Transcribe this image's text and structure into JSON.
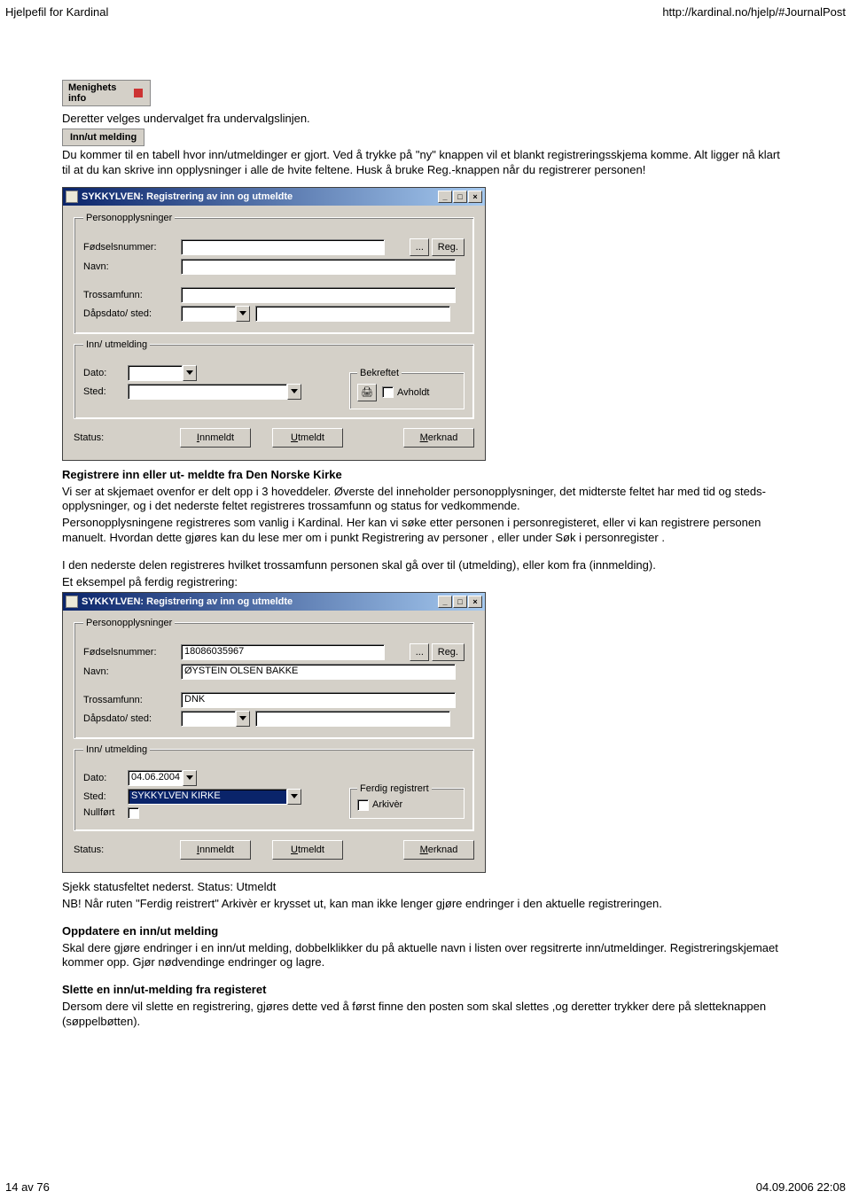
{
  "page": {
    "header_left": "Hjelpefil for Kardinal",
    "header_right": "http://kardinal.no/hjelp/#JournalPost",
    "footer_left": "14 av 76",
    "footer_right": "04.09.2006 22:08"
  },
  "menu_buttons": {
    "menighets_info": "Menighets\ninfo",
    "inn_ut_melding": "Inn/ut melding"
  },
  "text": {
    "p1": "Deretter velges undervalget fra undervalgslinjen.",
    "p2": "Du kommer til en tabell hvor inn/utmeldinger er gjort. Ved å trykke på \"ny\" knappen vil et blankt registreringsskjema komme. Alt ligger nå klart til at du kan skrive inn opplysninger i alle de hvite feltene. Husk å bruke Reg.-knappen når du registrerer personen!",
    "h1": "Registrere inn eller ut- meldte fra Den Norske Kirke",
    "p3": "Vi ser at skjemaet ovenfor er delt opp i 3 hoveddeler. Øverste del inneholder personopplysninger, det midterste feltet har med tid og steds-opplysninger, og i det nederste feltet registreres trossamfunn og status for vedkommende.",
    "p4": "Personopplysningene registreres som vanlig i Kardinal. Her kan vi søke etter personen i personregisteret, eller vi kan registrere personen manuelt. Hvordan dette gjøres kan du lese mer om i punkt Registrering av personer , eller under Søk i personregister .",
    "p5": "I den nederste delen registreres hvilket trossamfunn personen skal gå over til (utmelding), eller kom fra (innmelding).",
    "p6": "Et eksempel på ferdig registrering:",
    "p7": "Sjekk statusfeltet nederst. Status: Utmeldt",
    "p8": "NB! Når ruten \"Ferdig reistrert\" Arkivèr er krysset ut, kan man ikke lenger gjøre endringer i den aktuelle registreringen.",
    "h2": "Oppdatere en inn/ut melding",
    "p9": "Skal dere gjøre endringer i en inn/ut melding, dobbelklikker du på aktuelle navn i listen over regsitrerte inn/utmeldinger. Registreringskjemaet kommer opp. Gjør nødvendinge endringer og lagre.",
    "h3": "Slette en inn/ut-melding fra registeret",
    "p10": "Dersom dere vil slette en registrering, gjøres dette ved å først finne den posten som skal slettes ,og deretter trykker dere på sletteknappen (søppelbøtten)."
  },
  "dialog": {
    "title": "SYKKYLVEN: Registrering av inn og utmeldte",
    "labels": {
      "personopplysninger": "Personopplysninger",
      "fodselsnummer": "Fødselsnummer:",
      "navn": "Navn:",
      "trossamfunn": "Trossamfunn:",
      "dapsdato_sted": "Dåpsdato/ sted:",
      "inn_utmelding": "Inn/ utmelding",
      "dato": "Dato:",
      "sted": "Sted:",
      "nullfort": "Nullført",
      "bekreftet": "Bekreftet",
      "avholdt": "Avholdt",
      "ferdig_registrert": "Ferdig registrert",
      "arkiver": "Arkivèr",
      "status": "Status:"
    },
    "buttons": {
      "browse": "...",
      "reg": "Reg.",
      "innmeldt_i": "I",
      "innmeldt_rest": "nnmeldt",
      "utmeldt_u": "U",
      "utmeldt_rest": "tmeldt",
      "merknad_m": "M",
      "merknad_rest": "erknad"
    },
    "values_empty": {
      "fodselsnummer": "",
      "navn": "",
      "trossamfunn": "",
      "dapsdato": "",
      "dapssted": "",
      "dato": "",
      "sted": ""
    },
    "values_filled": {
      "fodselsnummer": "18086035967",
      "navn": "ØYSTEIN OLSEN BAKKE",
      "trossamfunn": "DNK",
      "dapsdato": "",
      "dapssted": "",
      "dato": "04.06.2004",
      "sted": "SYKKYLVEN KIRKE"
    }
  }
}
